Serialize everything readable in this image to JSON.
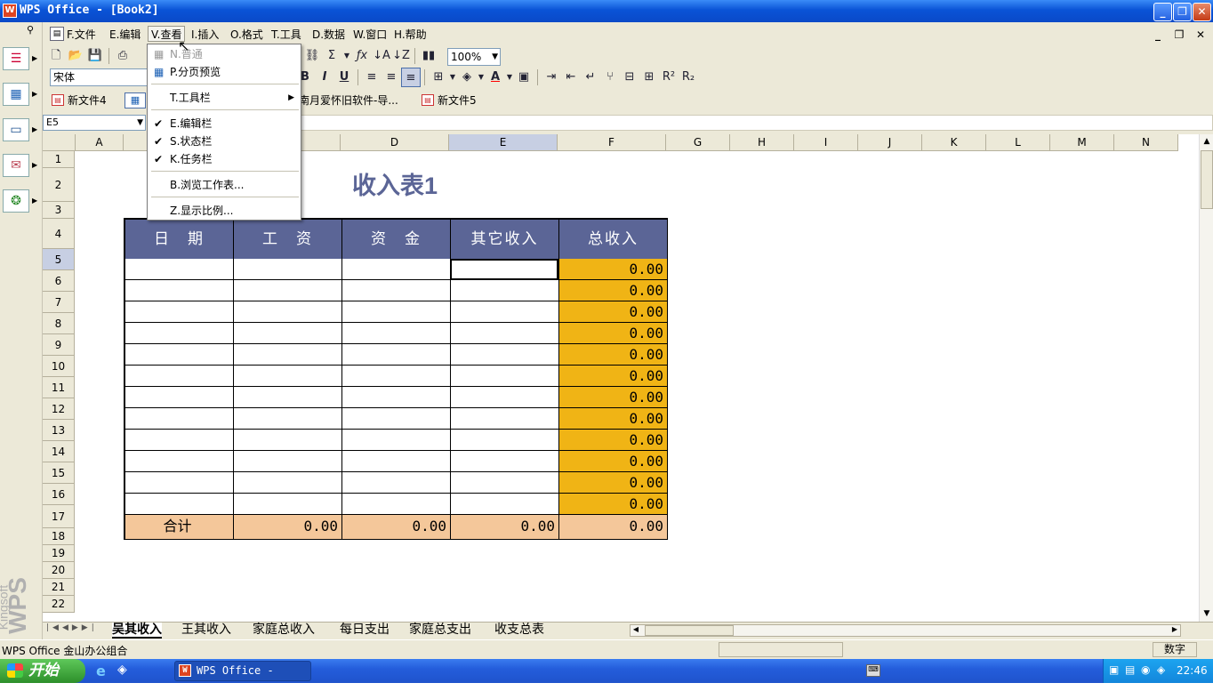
{
  "window": {
    "title": "WPS Office - [Book2]",
    "minimize": "_",
    "restore": "❐",
    "close": "✕"
  },
  "menu": [
    {
      "key": "F",
      "label": "F.文件"
    },
    {
      "key": "E",
      "label": "E.编辑"
    },
    {
      "key": "V",
      "label": "V.查看"
    },
    {
      "key": "I",
      "label": "I.插入"
    },
    {
      "key": "O",
      "label": "O.格式"
    },
    {
      "key": "T",
      "label": "T.工具"
    },
    {
      "key": "D",
      "label": "D.数据"
    },
    {
      "key": "W",
      "label": "W.窗口"
    },
    {
      "key": "H",
      "label": "H.帮助"
    }
  ],
  "view_menu": {
    "normal": "N.普通",
    "page_break": "P.分页预览",
    "toolbars": "T.工具栏",
    "edit_bar": "E.编辑栏",
    "status_bar": "S.状态栏",
    "task_bar": "K.任务栏",
    "browse": "B.浏览工作表...",
    "zoom": "Z.显示比例..."
  },
  "toolbar": {
    "zoom": "100%",
    "font": "宋体"
  },
  "doc_tabs": [
    "新文件4",
    "南月爱怀旧软件-导...",
    "新文件5"
  ],
  "name_box": "E5",
  "columns": [
    "A",
    "B",
    "C",
    "D",
    "E",
    "F",
    "G",
    "H",
    "I",
    "J",
    "K",
    "L",
    "M",
    "N"
  ],
  "rows": [
    "1",
    "2",
    "3",
    "4",
    "5",
    "6",
    "7",
    "8",
    "9",
    "10",
    "11",
    "12",
    "13",
    "14",
    "15",
    "16",
    "17",
    "18",
    "19",
    "20",
    "21",
    "22"
  ],
  "sheet": {
    "title": "收入表1",
    "headers": [
      "日　期",
      "工　资",
      "资　金",
      "其它收入",
      "总收入"
    ],
    "row_total": "0.00",
    "sum_label": "合计",
    "sum_values": [
      "0.00",
      "0.00",
      "0.00",
      "0.00"
    ]
  },
  "sheet_tabs": [
    "吴其收入",
    "王其收入",
    "家庭总收入",
    "每日支出",
    "家庭总支出",
    "收支总表"
  ],
  "status": {
    "left": "WPS Office 金山办公组合",
    "mode": "数字"
  },
  "taskbar": {
    "start": "开始",
    "task": "WPS Office - [Bo...",
    "clock": "22:46"
  },
  "brand": "WPS",
  "brand_small": "Kingsoft",
  "colors": {
    "header_bg": "#5b6596",
    "total_col": "#f0b415",
    "sum_row": "#f4c79a",
    "title": "#5b6596"
  }
}
